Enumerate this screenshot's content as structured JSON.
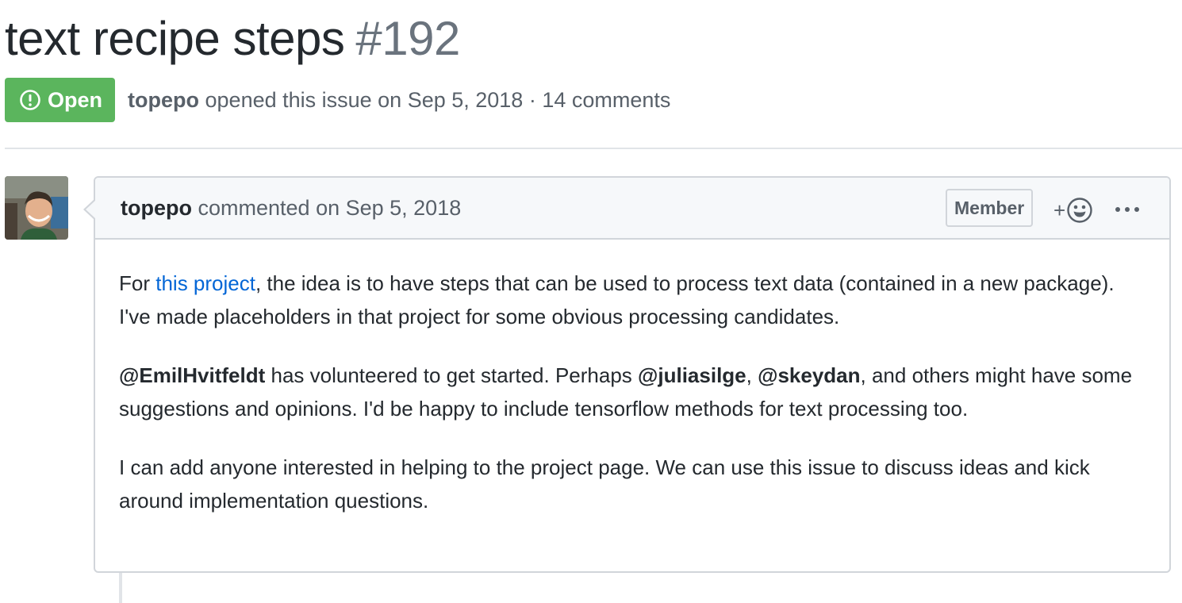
{
  "issue": {
    "title": "text recipe steps",
    "number": "#192",
    "state": "Open",
    "author": "topepo",
    "opened_text": "opened this issue on Sep 5, 2018 · 14 comments"
  },
  "comment": {
    "author": "topepo",
    "action": "commented on Sep 5, 2018",
    "role_badge": "Member",
    "reaction_plus": "+",
    "paragraphs": {
      "p1": {
        "before": "For ",
        "link": "this project",
        "after": ", the idea is to have steps that can be used to process text data (contained in a new package). I've made placeholders in that project for some obvious processing candidates."
      },
      "p2": {
        "mention1": "@EmilHvitfeldt",
        "text1": " has volunteered to get started. Perhaps ",
        "mention2": "@juliasilge",
        "text2": ", ",
        "mention3": "@skeydan",
        "text3": ", and others might have some suggestions and opinions. I'd be happy to include tensorflow methods for text processing too."
      },
      "p3": {
        "text": "I can add anyone interested in helping to the project page. We can use this issue to discuss ideas and kick around implementation questions."
      }
    }
  },
  "colors": {
    "open_green": "#5bb55d",
    "link_blue": "#0366d6",
    "border_gray": "#d1d5da",
    "header_bg": "#f6f8fa"
  },
  "icons": {
    "state": "issue-opened-icon",
    "reaction": "smiley-icon",
    "more": "kebab-horizontal-icon"
  }
}
